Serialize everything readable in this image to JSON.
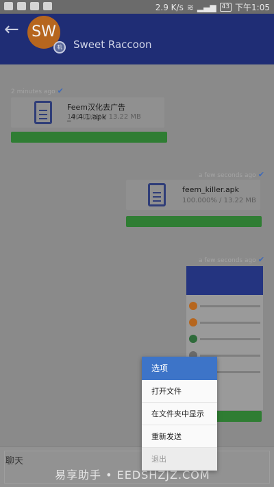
{
  "status": {
    "speed": "2.9 K/s",
    "battery": "43",
    "time": "下午1:05",
    "icons": [
      "ai-icon",
      "cloud-icon",
      "cloud-upload-icon",
      "shield-icon",
      "wifi-icon",
      "signal-icon"
    ]
  },
  "appbar": {
    "back": "←",
    "avatar_initials": "SW",
    "avatar_badge": "机",
    "title": "Sweet Raccoon"
  },
  "messages": [
    {
      "time": "2 minutes ago",
      "filename": "Feem汉化去广告_4.4.1.apk",
      "progress_text": "100.000% / 13.22 MB",
      "progress": 1.0
    },
    {
      "time": "a few seconds ago",
      "filename": "feem_killer.apk",
      "progress_text": "100.000% / 13.22 MB",
      "progress": 1.0
    },
    {
      "time": "a few seconds ago",
      "progress": 1.0
    }
  ],
  "thumbnail_colors": [
    "#b6661e",
    "#2f6b3b",
    "#6a6a6a"
  ],
  "menu": {
    "title": "选项",
    "items": [
      "打开文件",
      "在文件夹中显示",
      "重新发送",
      "退出"
    ]
  },
  "input": {
    "label": "聊天"
  },
  "watermark": "易享助手 • EEDSHZJZ.COM",
  "colors": {
    "appbar": "#1f2d75",
    "progress": "#2f7d33",
    "accent": "#3d74c8"
  }
}
